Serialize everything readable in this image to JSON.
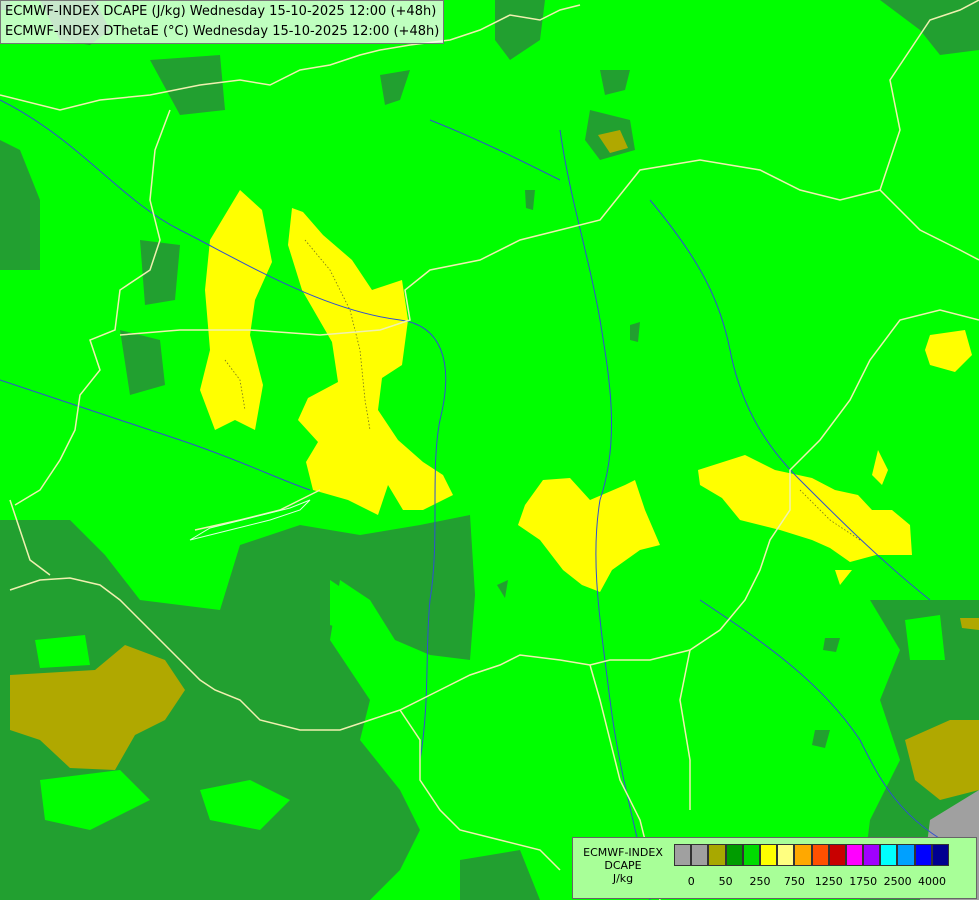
{
  "header": {
    "line1": "ECMWF-INDEX DCAPE (J/kg) Wednesday 15-10-2025 12:00 (+48h)",
    "line2": "ECMWF-INDEX DThetaE (°C) Wednesday 15-10-2025 12:00 (+48h)"
  },
  "legend": {
    "model": "ECMWF-INDEX",
    "param": "DCAPE",
    "unit": "J/kg",
    "colors": [
      "#a0a0a0",
      "#a0a0a0",
      "#a8a800",
      "#009c00",
      "#00dc00",
      "#ffff00",
      "#ffff80",
      "#ffa800",
      "#ff5000",
      "#c80000",
      "#ff00ff",
      "#a000ff",
      "#00ffff",
      "#00a0ff",
      "#0000ff",
      "#000090"
    ],
    "tick_labels": [
      "0",
      "50",
      "250",
      "750",
      "1250",
      "1750",
      "2500",
      "4000"
    ]
  },
  "map_colors": {
    "base": "#00ff00",
    "dark": "#22a030",
    "olive": "#b0a800",
    "yellow": "#ffff00",
    "gray": "#a0a0a0",
    "border": "#f0f0b0",
    "river": "#3050d0"
  }
}
